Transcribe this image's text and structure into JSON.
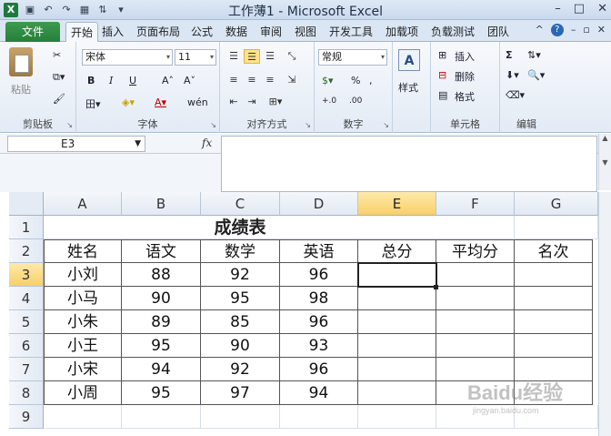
{
  "window": {
    "title": "工作薄1 - Microsoft Excel",
    "minimize": "–",
    "maximize": "□",
    "close": "✕"
  },
  "ribbon_tabs": {
    "file": "文件",
    "items": [
      "开始",
      "插入",
      "页面布局",
      "公式",
      "数据",
      "审阅",
      "视图",
      "开发工具",
      "加载项",
      "负载测试",
      "团队"
    ],
    "active": "开始"
  },
  "clipboard": {
    "paste": "粘贴",
    "label": "剪贴板"
  },
  "font": {
    "name": "宋体",
    "size": "11",
    "bold": "B",
    "italic": "I",
    "underline": "U",
    "grow": "A˄",
    "shrink": "A˅",
    "label": "字体",
    "phonetic": "wén"
  },
  "alignment": {
    "label": "对齐方式"
  },
  "number": {
    "format": "常规",
    "percent": "%",
    "comma": ",",
    "inc_decimal": "+.0",
    "dec_decimal": ".00",
    "label": "数字"
  },
  "styles": {
    "label": "样式"
  },
  "cells": {
    "insert": "插入",
    "delete": "删除",
    "format": "格式",
    "label": "单元格"
  },
  "editing": {
    "sum": "Σ",
    "label": "编辑"
  },
  "formula_bar": {
    "name_box": "E3",
    "fx": "fx",
    "value": ""
  },
  "columns": [
    "A",
    "B",
    "C",
    "D",
    "E",
    "F",
    "G"
  ],
  "selected_column": "E",
  "rows": [
    "1",
    "2",
    "3",
    "4",
    "5",
    "6",
    "7",
    "8",
    "9"
  ],
  "selected_row": "3",
  "sheet": {
    "title": "成绩表",
    "headers": [
      "姓名",
      "语文",
      "数学",
      "英语",
      "总分",
      "平均分",
      "名次"
    ],
    "data": [
      [
        "小刘",
        "88",
        "92",
        "96"
      ],
      [
        "小马",
        "90",
        "95",
        "98"
      ],
      [
        "小朱",
        "89",
        "85",
        "96"
      ],
      [
        "小王",
        "95",
        "90",
        "93"
      ],
      [
        "小宋",
        "94",
        "92",
        "96"
      ],
      [
        "小周",
        "95",
        "97",
        "94"
      ]
    ],
    "selected_cell": "E3"
  },
  "watermark": {
    "brand": "Baidu经验",
    "url": "jingyan.baidu.com"
  }
}
